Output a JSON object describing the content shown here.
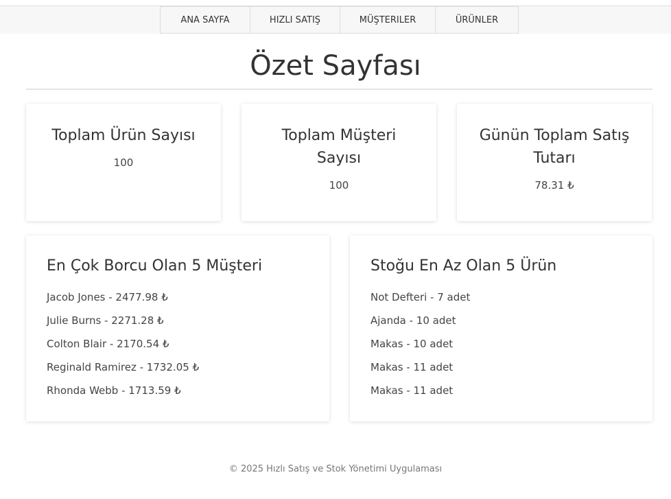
{
  "nav": {
    "items": [
      {
        "label": "ANA SAYFA"
      },
      {
        "label": "HIZLI SATIŞ"
      },
      {
        "label": "MÜŞTERILER"
      },
      {
        "label": "ÜRÜNLER"
      }
    ]
  },
  "page": {
    "title": "Özet Sayfası"
  },
  "stats": [
    {
      "title": "Toplam Ürün Sayısı",
      "value": "100"
    },
    {
      "title": "Toplam Müşteri Sayısı",
      "value": "100"
    },
    {
      "title": "Günün Toplam Satış Tutarı",
      "value": "78.31 ₺"
    }
  ],
  "debtors": {
    "title": "En Çok Borcu Olan 5 Müşteri",
    "items": [
      "Jacob Jones - 2477.98 ₺",
      "Julie Burns - 2271.28 ₺",
      "Colton Blair - 2170.54 ₺",
      "Reginald Ramirez - 1732.05 ₺",
      "Rhonda Webb - 1713.59 ₺"
    ]
  },
  "low_stock": {
    "title": "Stoğu En Az Olan 5 Ürün",
    "items": [
      "Not Defteri - 7 adet",
      "Ajanda - 10 adet",
      "Makas - 10 adet",
      "Makas - 11 adet",
      "Makas - 11 adet"
    ]
  },
  "footer": {
    "text": "© 2025 Hızlı Satış ve Stok Yönetimi Uygulaması"
  }
}
